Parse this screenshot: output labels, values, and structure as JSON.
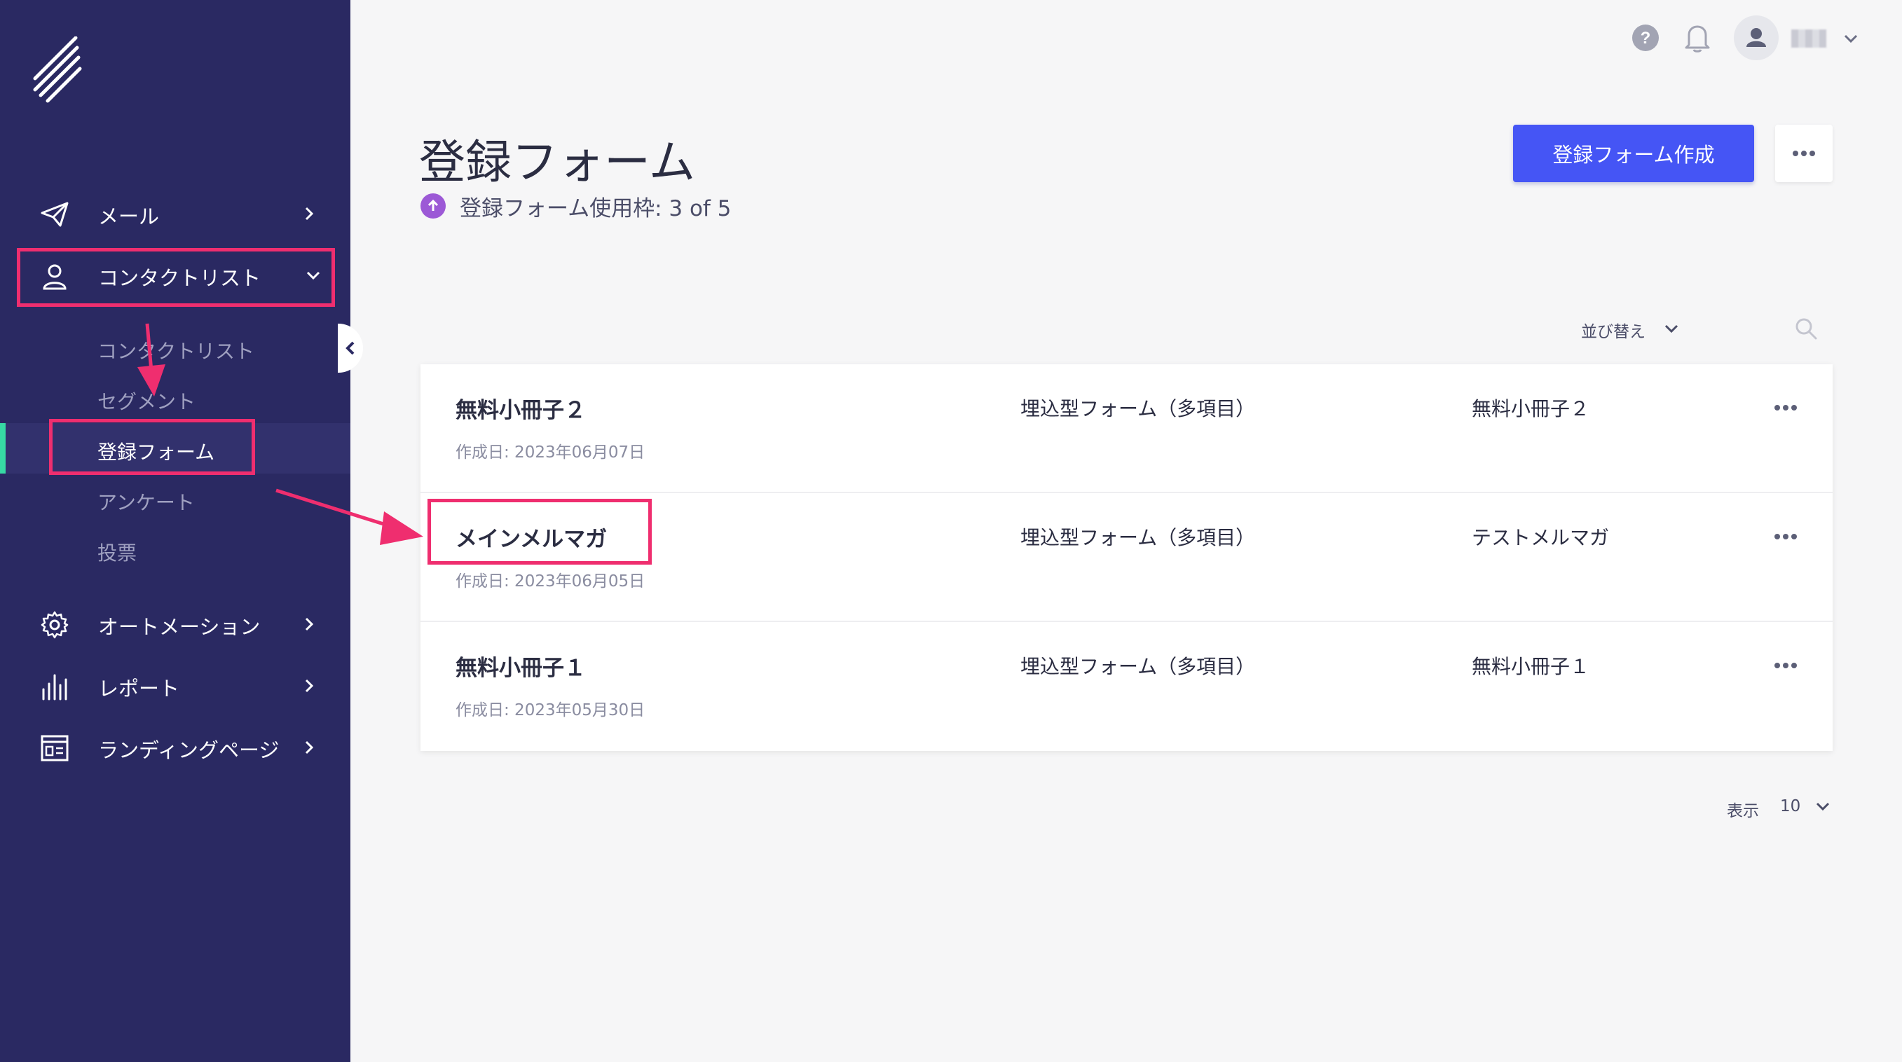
{
  "sidebar": {
    "nav": {
      "mail": "メール",
      "contact_list": "コンタクトリスト",
      "automation": "オートメーション",
      "report": "レポート",
      "landing_page": "ランディングページ"
    },
    "sub": {
      "contact_list": "コンタクトリスト",
      "segment": "セグメント",
      "signup_form": "登録フォーム",
      "survey": "アンケート",
      "vote": "投票"
    },
    "active_color": "#37d9a4",
    "background": "#2a2962"
  },
  "header": {
    "title": "登録フォーム",
    "quota": "登録フォーム使用枠: 3 of 5",
    "create_button": "登録フォーム作成"
  },
  "toolbar": {
    "sort_label": "並び替え"
  },
  "forms": [
    {
      "name": "無料小冊子２",
      "created": "作成日: 2023年06月07日",
      "type": "埋込型フォーム（多項目）",
      "list": "無料小冊子２"
    },
    {
      "name": "メインメルマガ",
      "created": "作成日: 2023年06月05日",
      "type": "埋込型フォーム（多項目）",
      "list": "テストメルマガ"
    },
    {
      "name": "無料小冊子１",
      "created": "作成日: 2023年05月30日",
      "type": "埋込型フォーム（多項目）",
      "list": "無料小冊子１"
    }
  ],
  "pagination": {
    "label": "表示",
    "per_page": "10"
  },
  "colors": {
    "primary_button": "#4555f5",
    "annotation": "#ef2e6f",
    "quota_icon": "#9c59d6"
  }
}
